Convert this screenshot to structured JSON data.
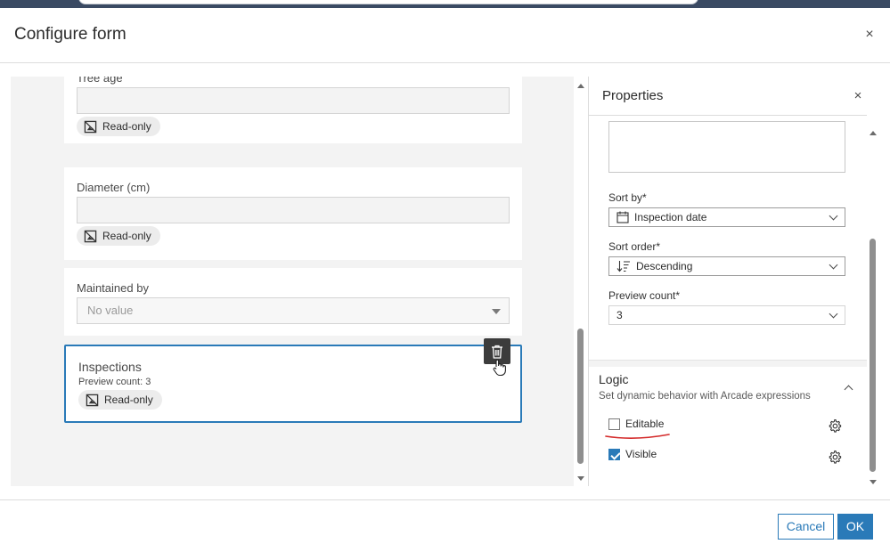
{
  "dialog": {
    "title": "Configure form",
    "close_symbol": "×"
  },
  "form": {
    "tree_age": {
      "label": "Tree age",
      "chip": "Read-only"
    },
    "diameter": {
      "label": "Diameter (cm)",
      "chip": "Read-only"
    },
    "maintained_by": {
      "label": "Maintained by",
      "placeholder": "No value"
    },
    "inspections": {
      "label": "Inspections",
      "preview": "Preview count: 3",
      "chip": "Read-only"
    }
  },
  "properties": {
    "title": "Properties",
    "close_symbol": "×",
    "sort_by": {
      "label": "Sort by*",
      "value": "Inspection date"
    },
    "sort_order": {
      "label": "Sort order*",
      "value": "Descending"
    },
    "preview_count": {
      "label": "Preview count*",
      "value": "3"
    },
    "logic": {
      "title": "Logic",
      "description": "Set dynamic behavior with Arcade expressions",
      "editable": {
        "label": "Editable",
        "checked": false
      },
      "visible": {
        "label": "Visible",
        "checked": true
      }
    }
  },
  "footer": {
    "cancel_label": "Cancel",
    "ok_label": "OK"
  },
  "icons": [
    "read-only-icon",
    "trash-icon",
    "pointer-hand-icon",
    "calendar-icon",
    "sort-descending-icon",
    "gear-icon",
    "close-icon",
    "chevron-down-icon",
    "chevron-up-icon"
  ],
  "colors": {
    "accent": "#2a7ab8",
    "annotation": "#d42a2a"
  }
}
